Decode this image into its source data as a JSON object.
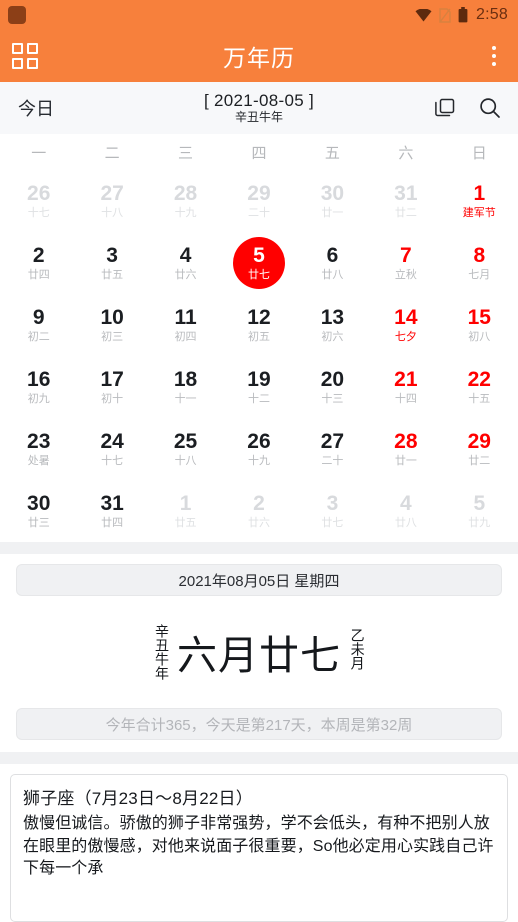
{
  "status_bar": {
    "time": "2:58",
    "icons": [
      "wifi-icon",
      "sim-off-icon",
      "battery-icon"
    ]
  },
  "appbar": {
    "title": "万年历",
    "grid_icon": "grid-icon",
    "overflow_icon": "more-vertical-icon"
  },
  "subbar": {
    "today_label": "今日",
    "date_label": "[ 2021-08-05 ]",
    "lunar_year_label": "辛丑牛年",
    "layers_icon": "layers-icon",
    "search_icon": "search-icon"
  },
  "calendar": {
    "weekdays": [
      "一",
      "二",
      "三",
      "四",
      "五",
      "六",
      "日"
    ],
    "days": [
      {
        "num": "26",
        "sub": "十七",
        "type": "other"
      },
      {
        "num": "27",
        "sub": "十八",
        "type": "other"
      },
      {
        "num": "28",
        "sub": "十九",
        "type": "other"
      },
      {
        "num": "29",
        "sub": "二十",
        "type": "other"
      },
      {
        "num": "30",
        "sub": "廿一",
        "type": "other"
      },
      {
        "num": "31",
        "sub": "廿二",
        "type": "other"
      },
      {
        "num": "1",
        "sub": "建军节",
        "type": "weekend festival"
      },
      {
        "num": "2",
        "sub": "廿四",
        "type": ""
      },
      {
        "num": "3",
        "sub": "廿五",
        "type": ""
      },
      {
        "num": "4",
        "sub": "廿六",
        "type": ""
      },
      {
        "num": "5",
        "sub": "廿七",
        "type": "selected"
      },
      {
        "num": "6",
        "sub": "廿八",
        "type": ""
      },
      {
        "num": "7",
        "sub": "立秋",
        "type": "weekend"
      },
      {
        "num": "8",
        "sub": "七月",
        "type": "weekend"
      },
      {
        "num": "9",
        "sub": "初二",
        "type": ""
      },
      {
        "num": "10",
        "sub": "初三",
        "type": ""
      },
      {
        "num": "11",
        "sub": "初四",
        "type": ""
      },
      {
        "num": "12",
        "sub": "初五",
        "type": ""
      },
      {
        "num": "13",
        "sub": "初六",
        "type": ""
      },
      {
        "num": "14",
        "sub": "七夕",
        "type": "weekend festival"
      },
      {
        "num": "15",
        "sub": "初八",
        "type": "weekend"
      },
      {
        "num": "16",
        "sub": "初九",
        "type": ""
      },
      {
        "num": "17",
        "sub": "初十",
        "type": ""
      },
      {
        "num": "18",
        "sub": "十一",
        "type": ""
      },
      {
        "num": "19",
        "sub": "十二",
        "type": ""
      },
      {
        "num": "20",
        "sub": "十三",
        "type": ""
      },
      {
        "num": "21",
        "sub": "十四",
        "type": "weekend"
      },
      {
        "num": "22",
        "sub": "十五",
        "type": "weekend"
      },
      {
        "num": "23",
        "sub": "处暑",
        "type": ""
      },
      {
        "num": "24",
        "sub": "十七",
        "type": ""
      },
      {
        "num": "25",
        "sub": "十八",
        "type": ""
      },
      {
        "num": "26",
        "sub": "十九",
        "type": ""
      },
      {
        "num": "27",
        "sub": "二十",
        "type": ""
      },
      {
        "num": "28",
        "sub": "廿一",
        "type": "weekend"
      },
      {
        "num": "29",
        "sub": "廿二",
        "type": "weekend"
      },
      {
        "num": "30",
        "sub": "廿三",
        "type": ""
      },
      {
        "num": "31",
        "sub": "廿四",
        "type": ""
      },
      {
        "num": "1",
        "sub": "廿五",
        "type": "other"
      },
      {
        "num": "2",
        "sub": "廿六",
        "type": "other"
      },
      {
        "num": "3",
        "sub": "廿七",
        "type": "other"
      },
      {
        "num": "4",
        "sub": "廿八",
        "type": "other"
      },
      {
        "num": "5",
        "sub": "廿九",
        "type": "other"
      }
    ]
  },
  "detail": {
    "full_date": "2021年08月05日 星期四",
    "lunar_year_vertical": "辛丑牛年",
    "lunar_date_main": "六月廿七",
    "lunar_month_vertical": "乙未月",
    "year_stats": "今年合计365，今天是第217天，本周是第32周"
  },
  "zodiac": {
    "title": "狮子座（7月23日～8月22日）",
    "description": "傲慢但诚信。骄傲的狮子非常强势，学不会低头，有种不把别人放在眼里的傲慢感，对他来说面子很重要，So他必定用心实践自己许下每一个承"
  },
  "colors": {
    "accent": "#F7803C",
    "highlight": "#FF0000",
    "subbar_bg": "#F7F8FA",
    "band": "#F0F1F3"
  }
}
